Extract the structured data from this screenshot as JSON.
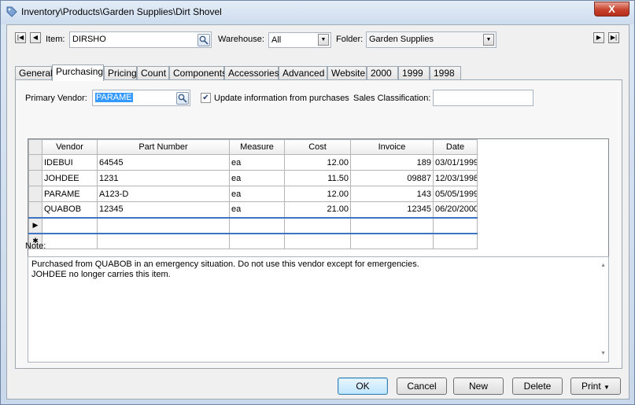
{
  "window": {
    "title": "Inventory\\Products\\Garden Supplies\\Dirt Shovel",
    "close_glyph": "X"
  },
  "header": {
    "nav_first_glyph": "|◀",
    "nav_prev_glyph": "◀",
    "nav_next_glyph": "▶",
    "nav_last_glyph": "▶|",
    "item_label": "Item:",
    "item_value": "DIRSHO",
    "warehouse_label": "Warehouse:",
    "warehouse_value": "All",
    "folder_label": "Folder:",
    "folder_value": "Garden Supplies"
  },
  "tabs": [
    {
      "label": "General"
    },
    {
      "label": "Purchasing"
    },
    {
      "label": "Pricing"
    },
    {
      "label": "Count"
    },
    {
      "label": "Components"
    },
    {
      "label": "Accessories"
    },
    {
      "label": "Advanced"
    },
    {
      "label": "Website"
    },
    {
      "label": "2000"
    },
    {
      "label": "1999"
    },
    {
      "label": "1998"
    }
  ],
  "active_tab": "Purchasing",
  "purchasing": {
    "primary_vendor_label": "Primary Vendor:",
    "primary_vendor_value": "PARAME",
    "update_checkbox_label": "Update information from purchases",
    "update_checked": true,
    "sales_class_label": "Sales Classification:",
    "sales_class_value": ""
  },
  "grid": {
    "columns": [
      "Vendor",
      "Part Number",
      "Measure",
      "Cost",
      "Invoice",
      "Date"
    ],
    "rows": [
      {
        "vendor": "IDEBUI",
        "part": "64545",
        "measure": "ea",
        "cost": "12.00",
        "invoice": "189",
        "date": "03/01/1999"
      },
      {
        "vendor": "JOHDEE",
        "part": "1231",
        "measure": "ea",
        "cost": "11.50",
        "invoice": "09887",
        "date": "12/03/1998"
      },
      {
        "vendor": "PARAME",
        "part": "A123-D",
        "measure": "ea",
        "cost": "12.00",
        "invoice": "143",
        "date": "05/05/1999"
      },
      {
        "vendor": "QUABOB",
        "part": "12345",
        "measure": "ea",
        "cost": "21.00",
        "invoice": "12345",
        "date": "06/20/2000"
      }
    ],
    "current_row_glyph": "▶",
    "new_row_glyph": "✱"
  },
  "note": {
    "label": "Note:",
    "line1": "Purchased from QUABOB in an emergency situation.   Do not use this vendor except for emergencies.",
    "line2": "JOHDEE no longer carries this item."
  },
  "buttons": {
    "ok": "OK",
    "cancel": "Cancel",
    "new": "New",
    "delete": "Delete",
    "print": "Print",
    "print_arrow": "▼"
  }
}
